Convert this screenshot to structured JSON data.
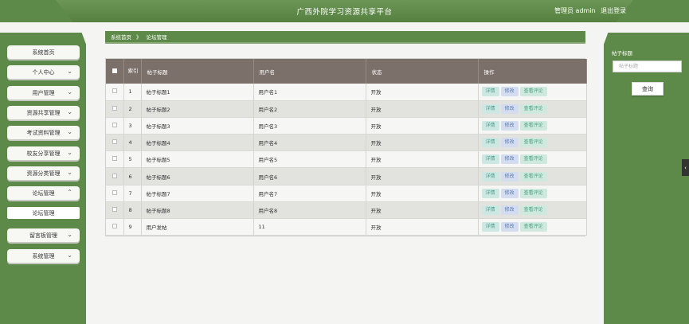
{
  "header": {
    "title": "广西外院学习资源共享平台",
    "user_role": "管理员",
    "username": "admin",
    "logout": "退出登录"
  },
  "sidebar": {
    "items": [
      {
        "label": "系统首页",
        "chevron": false
      },
      {
        "label": "个人中心",
        "chevron": true
      },
      {
        "label": "用户管理",
        "chevron": true
      },
      {
        "label": "资源共享管理",
        "chevron": true
      },
      {
        "label": "考试资料管理",
        "chevron": true
      },
      {
        "label": "校友分享管理",
        "chevron": true
      },
      {
        "label": "资源分类管理",
        "chevron": true
      },
      {
        "label": "论坛管理",
        "chevron": true,
        "expanded": true
      },
      {
        "label": "论坛管理",
        "sub": true
      },
      {
        "label": "留言板管理",
        "chevron": true
      },
      {
        "label": "系统管理",
        "chevron": true
      }
    ]
  },
  "breadcrumb": {
    "home": "系统首页",
    "separator": "》",
    "current": "论坛管理"
  },
  "table": {
    "headers": [
      "索引",
      "帖子标题",
      "用户名",
      "状态",
      "操作"
    ],
    "rows": [
      {
        "index": "1",
        "title": "帖子标题1",
        "user": "用户名1",
        "status": "开放"
      },
      {
        "index": "2",
        "title": "帖子标题2",
        "user": "用户名2",
        "status": "开放"
      },
      {
        "index": "3",
        "title": "帖子标题3",
        "user": "用户名3",
        "status": "开放"
      },
      {
        "index": "4",
        "title": "帖子标题4",
        "user": "用户名4",
        "status": "开放"
      },
      {
        "index": "5",
        "title": "帖子标题5",
        "user": "用户名5",
        "status": "开放"
      },
      {
        "index": "6",
        "title": "帖子标题6",
        "user": "用户名6",
        "status": "开放"
      },
      {
        "index": "7",
        "title": "帖子标题7",
        "user": "用户名7",
        "status": "开放"
      },
      {
        "index": "8",
        "title": "帖子标题8",
        "user": "用户名8",
        "status": "开放"
      },
      {
        "index": "9",
        "title": "用户发帖",
        "user": "11",
        "status": "开放"
      }
    ],
    "actions": {
      "detail": "详情",
      "edit": "修改",
      "comments": "查看评论"
    }
  },
  "search": {
    "label": "帖子标题",
    "placeholder": "帖子标题",
    "button": "查询"
  },
  "side_tab": {
    "icon": "chevron-left-icon",
    "glyph": "‹"
  },
  "colors": {
    "brand_green": "#5d8a48",
    "table_header": "#7c706a",
    "btn_detail": "#cde7e3",
    "btn_edit": "#d3ddef",
    "btn_comment": "#cfe9df"
  }
}
